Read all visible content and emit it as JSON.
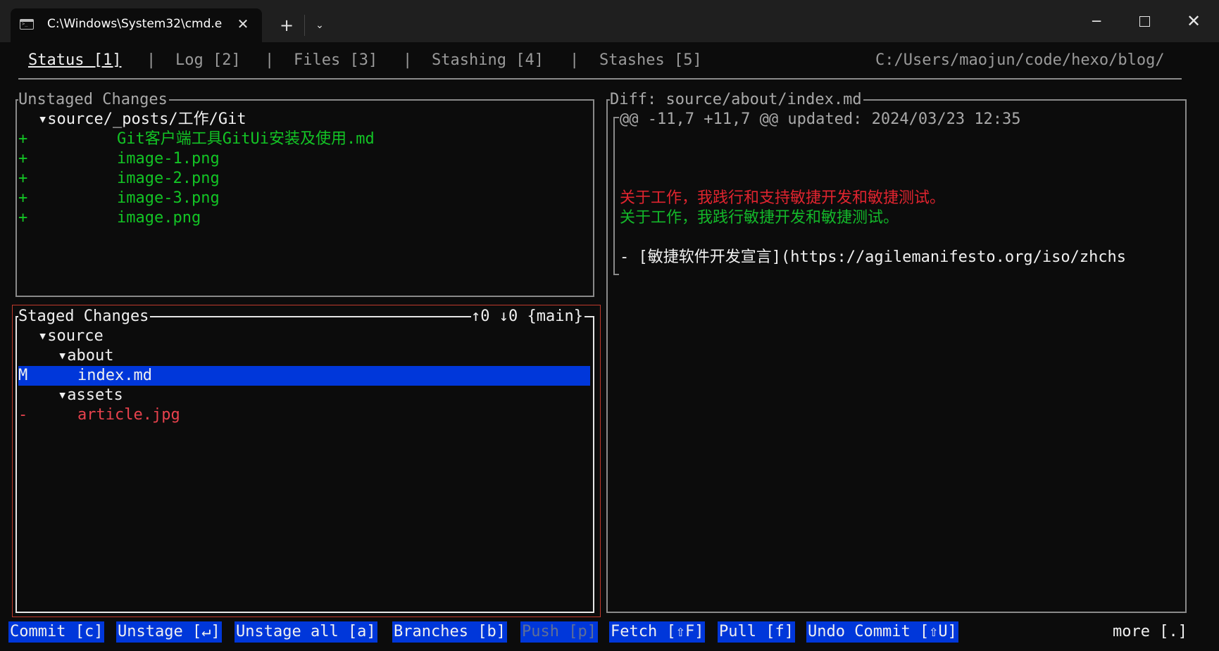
{
  "window": {
    "tab_title": "C:\\Windows\\System32\\cmd.e",
    "tab_icon": "terminal-icon",
    "new_tab": "+",
    "dropdown": "⌄",
    "minimize": "─",
    "close": "✕"
  },
  "menu": {
    "tabs": [
      {
        "label": "Status [1]"
      },
      {
        "label": "Log [2]"
      },
      {
        "label": "Files [3]"
      },
      {
        "label": "Stashing [4]"
      },
      {
        "label": "Stashes [5]"
      }
    ],
    "separator": "|",
    "path": "C:/Users/maojun/code/hexo/blog/"
  },
  "unstaged": {
    "title": "Unstaged Changes",
    "folder": "▾source/_posts/工作/Git",
    "files": [
      {
        "status": "+",
        "name": "Git客户端工具GitUi安装及使用.md"
      },
      {
        "status": "+",
        "name": "image-1.png"
      },
      {
        "status": "+",
        "name": "image-2.png"
      },
      {
        "status": "+",
        "name": "image-3.png"
      },
      {
        "status": "+",
        "name": "image.png"
      }
    ]
  },
  "staged": {
    "title": "Staged Changes",
    "branch_info": "↑0 ↓0 {main}",
    "tree": {
      "source": "▾source",
      "about": "▾about",
      "index_status": "M",
      "index_name": "index.md",
      "assets": "▾assets",
      "article_status": "-",
      "article_name": "article.jpg"
    }
  },
  "diff": {
    "title": "Diff: source/about/index.md",
    "hunk_header": "@@ -11,7 +11,7 @@ updated: 2024/03/23 12:35",
    "removed": "关于工作，我践行和支持敏捷开发和敏捷测试。",
    "added": "关于工作，我践行敏捷开发和敏捷测试。",
    "context": "- [敏捷软件开发宣言](https://agilemanifesto.org/iso/zhchs"
  },
  "keys": [
    {
      "label": "Commit [c]"
    },
    {
      "label": "Unstage [↵]"
    },
    {
      "label": "Unstage all [a]"
    },
    {
      "label": "Branches [b]"
    },
    {
      "label": "Push [p]"
    },
    {
      "label": "Fetch [⇧F]"
    },
    {
      "label": "Pull [f]"
    },
    {
      "label": "Undo Commit [⇧U]"
    }
  ],
  "more": "more [.]"
}
